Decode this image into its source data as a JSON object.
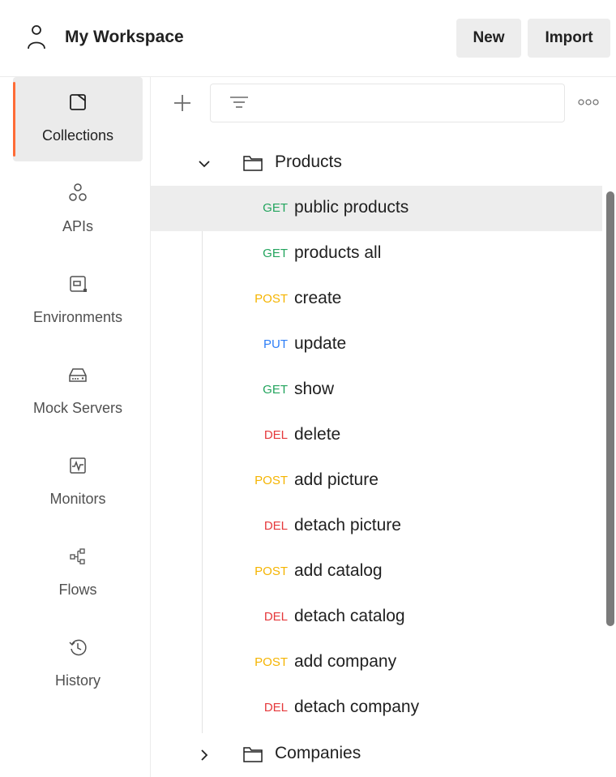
{
  "header": {
    "workspace_title": "My Workspace",
    "new_label": "New",
    "import_label": "Import"
  },
  "sidebar": {
    "items": [
      {
        "label": "Collections",
        "icon": "collections-icon",
        "active": true
      },
      {
        "label": "APIs",
        "icon": "apis-icon",
        "active": false
      },
      {
        "label": "Environments",
        "icon": "environments-icon",
        "active": false
      },
      {
        "label": "Mock Servers",
        "icon": "mock-servers-icon",
        "active": false
      },
      {
        "label": "Monitors",
        "icon": "monitors-icon",
        "active": false
      },
      {
        "label": "Flows",
        "icon": "flows-icon",
        "active": false
      },
      {
        "label": "History",
        "icon": "history-icon",
        "active": false
      }
    ]
  },
  "toolbar": {
    "filter_placeholder": ""
  },
  "tree": {
    "folders": [
      {
        "name": "Products",
        "expanded": true
      },
      {
        "name": "Companies",
        "expanded": false
      }
    ],
    "requests": [
      {
        "method": "GET",
        "name": "public products",
        "hovered": true
      },
      {
        "method": "GET",
        "name": "products all"
      },
      {
        "method": "POST",
        "name": "create"
      },
      {
        "method": "PUT",
        "name": "update"
      },
      {
        "method": "GET",
        "name": "show"
      },
      {
        "method": "DEL",
        "name": "delete"
      },
      {
        "method": "POST",
        "name": "add picture"
      },
      {
        "method": "DEL",
        "name": "detach picture"
      },
      {
        "method": "POST",
        "name": "add catalog"
      },
      {
        "method": "DEL",
        "name": "detach catalog"
      },
      {
        "method": "POST",
        "name": "add company"
      },
      {
        "method": "DEL",
        "name": "detach company"
      }
    ]
  },
  "colors": {
    "accent": "#ff6c37",
    "GET": "#22a45d",
    "POST": "#f5b400",
    "PUT": "#2d7ef7",
    "DEL": "#e5383b"
  }
}
